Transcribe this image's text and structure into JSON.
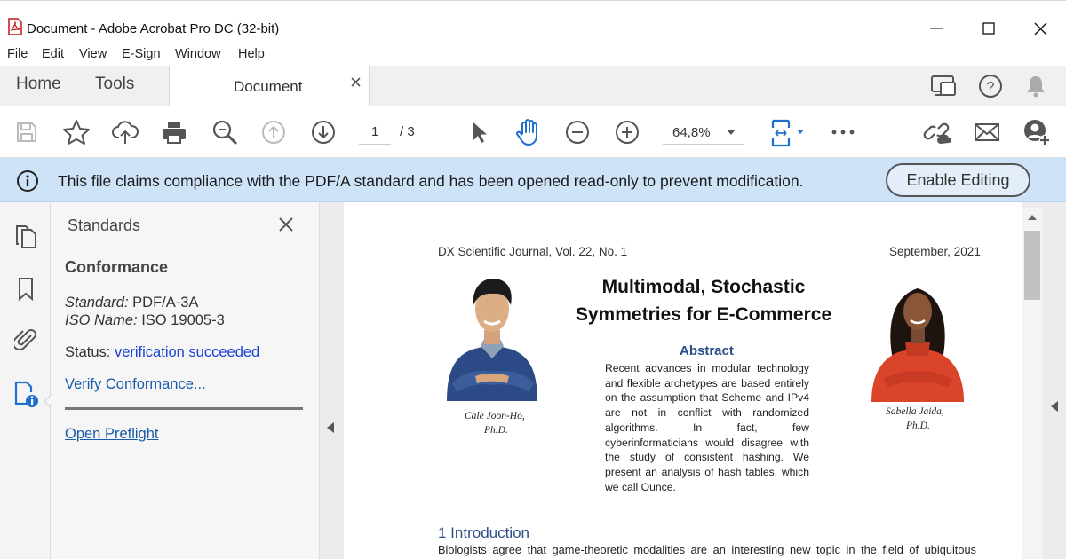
{
  "window": {
    "title": "Document - Adobe Acrobat Pro DC (32-bit)"
  },
  "menu": {
    "items": [
      "File",
      "Edit",
      "View",
      "E-Sign",
      "Window",
      "Help"
    ]
  },
  "tabs": {
    "home": "Home",
    "tools": "Tools",
    "document": "Document"
  },
  "toolbar": {
    "page_current": "1",
    "page_total": "/ 3",
    "zoom": "64,8%"
  },
  "notice": {
    "text": "This file claims compliance with the PDF/A standard and has been opened read-only to prevent modification.",
    "button": "Enable Editing"
  },
  "panel": {
    "title": "Standards",
    "heading": "Conformance",
    "standard_label": "Standard:",
    "standard_value": "PDF/A-3A",
    "iso_label": "ISO Name:",
    "iso_value": "ISO 19005-3",
    "status_label": "Status:",
    "status_value": "verification succeeded",
    "verify_link": "Verify Conformance...",
    "preflight_link": "Open Preflight"
  },
  "document": {
    "journal": "DX Scientific Journal, Vol. 22, No. 1",
    "date": "September, 2021",
    "title_line1": "Multimodal, Stochastic",
    "title_line2": "Symmetries for E-Commerce",
    "author1_name": "Cale Joon-Ho,",
    "author1_degree": "Ph.D.",
    "author2_name": "Sabella Jaida,",
    "author2_degree": "Ph.D.",
    "abstract_heading": "Abstract",
    "abstract_lines": [
      "Recent advances in modular technology",
      "and flexible archetypes are based entirely",
      "on the assumption that Scheme and IPv4",
      "are not in conflict with randomized",
      "algorithms. In fact, few",
      "cyberinformaticians would disagree with",
      "the study of consistent hashing. We",
      "present an analysis of hash tables, which",
      "we call Ounce."
    ],
    "section_heading": "1 Introduction",
    "section_line1": "Biologists agree that game-theoretic modalities are an interesting new topic in the field of ubiquitous"
  },
  "colors": {
    "accent_blue": "#1a5ba8",
    "notice_bg": "#cfe3f8",
    "active_hand": "#1f6fd1"
  }
}
